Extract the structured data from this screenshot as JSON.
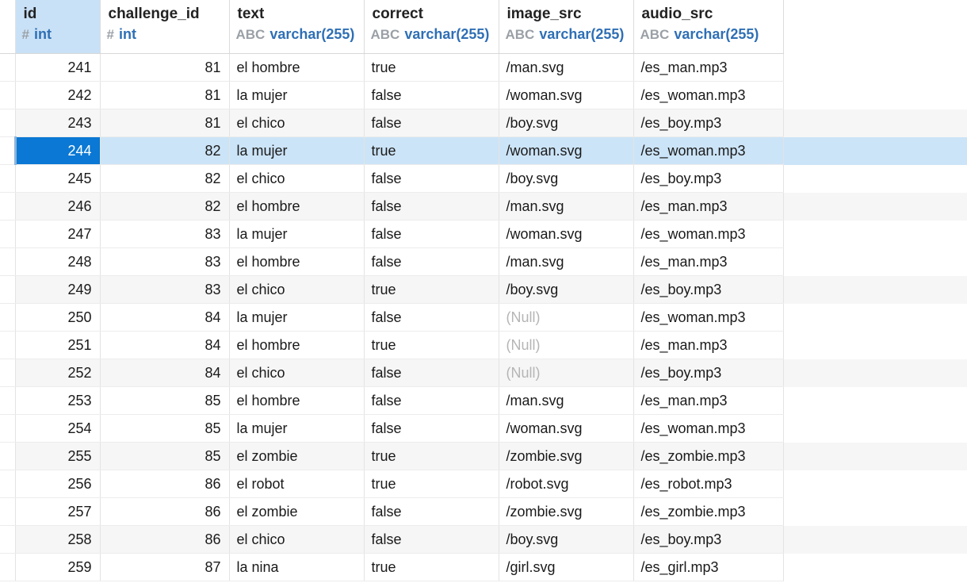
{
  "columns": [
    {
      "name": "id",
      "type": "int",
      "type_icon": "#",
      "align": "num"
    },
    {
      "name": "challenge_id",
      "type": "int",
      "type_icon": "#",
      "align": "num"
    },
    {
      "name": "text",
      "type": "varchar(255)",
      "type_icon": "ABC",
      "align": "txt"
    },
    {
      "name": "correct",
      "type": "varchar(255)",
      "type_icon": "ABC",
      "align": "txt"
    },
    {
      "name": "image_src",
      "type": "varchar(255)",
      "type_icon": "ABC",
      "align": "txt"
    },
    {
      "name": "audio_src",
      "type": "varchar(255)",
      "type_icon": "ABC",
      "align": "txt"
    }
  ],
  "selected_row_id": "244",
  "rows": [
    [
      "241",
      "81",
      "el hombre",
      "true",
      "/man.svg",
      "/es_man.mp3"
    ],
    [
      "242",
      "81",
      "la mujer",
      "false",
      "/woman.svg",
      "/es_woman.mp3"
    ],
    [
      "243",
      "81",
      "el chico",
      "false",
      "/boy.svg",
      "/es_boy.mp3"
    ],
    [
      "244",
      "82",
      "la mujer",
      "true",
      "/woman.svg",
      "/es_woman.mp3"
    ],
    [
      "245",
      "82",
      "el chico",
      "false",
      "/boy.svg",
      "/es_boy.mp3"
    ],
    [
      "246",
      "82",
      "el hombre",
      "false",
      "/man.svg",
      "/es_man.mp3"
    ],
    [
      "247",
      "83",
      "la mujer",
      "false",
      "/woman.svg",
      "/es_woman.mp3"
    ],
    [
      "248",
      "83",
      "el hombre",
      "false",
      "/man.svg",
      "/es_man.mp3"
    ],
    [
      "249",
      "83",
      "el chico",
      "true",
      "/boy.svg",
      "/es_boy.mp3"
    ],
    [
      "250",
      "84",
      "la mujer",
      "false",
      "(Null)",
      "/es_woman.mp3"
    ],
    [
      "251",
      "84",
      "el hombre",
      "true",
      "(Null)",
      "/es_man.mp3"
    ],
    [
      "252",
      "84",
      "el chico",
      "false",
      "(Null)",
      "/es_boy.mp3"
    ],
    [
      "253",
      "85",
      "el hombre",
      "false",
      "/man.svg",
      "/es_man.mp3"
    ],
    [
      "254",
      "85",
      "la mujer",
      "false",
      "/woman.svg",
      "/es_woman.mp3"
    ],
    [
      "255",
      "85",
      "el zombie",
      "true",
      "/zombie.svg",
      "/es_zombie.mp3"
    ],
    [
      "256",
      "86",
      "el robot",
      "true",
      "/robot.svg",
      "/es_robot.mp3"
    ],
    [
      "257",
      "86",
      "el zombie",
      "false",
      "/zombie.svg",
      "/es_zombie.mp3"
    ],
    [
      "258",
      "86",
      "el chico",
      "false",
      "/boy.svg",
      "/es_boy.mp3"
    ],
    [
      "259",
      "87",
      "la nina",
      "true",
      "/girl.svg",
      "/es_girl.mp3"
    ]
  ],
  "null_label": "(Null)",
  "colors": {
    "selection": "#0a78d4",
    "selected_row": "#cce4f7",
    "type_text": "#2f6fb5",
    "null_text": "#b5b5b5"
  }
}
